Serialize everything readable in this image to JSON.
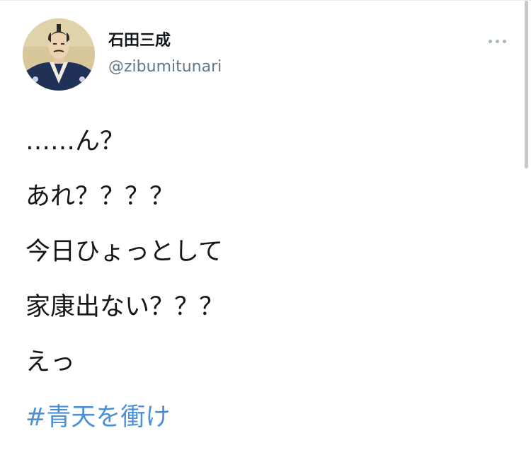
{
  "author": {
    "display_name": "石田三成",
    "handle": "@zibumitunari",
    "avatar_icon": "samurai-portrait-avatar"
  },
  "menu": {
    "icon": "more-options-icon"
  },
  "tweet": {
    "lines": [
      "……ん？",
      "あれ？？？？",
      "今日ひょっとして",
      "家康出ない？？？",
      "えっ"
    ],
    "hashtag": "#青天を衝け"
  },
  "colors": {
    "text": "#14171a",
    "secondary": "#657786",
    "link": "#4a90d9"
  }
}
